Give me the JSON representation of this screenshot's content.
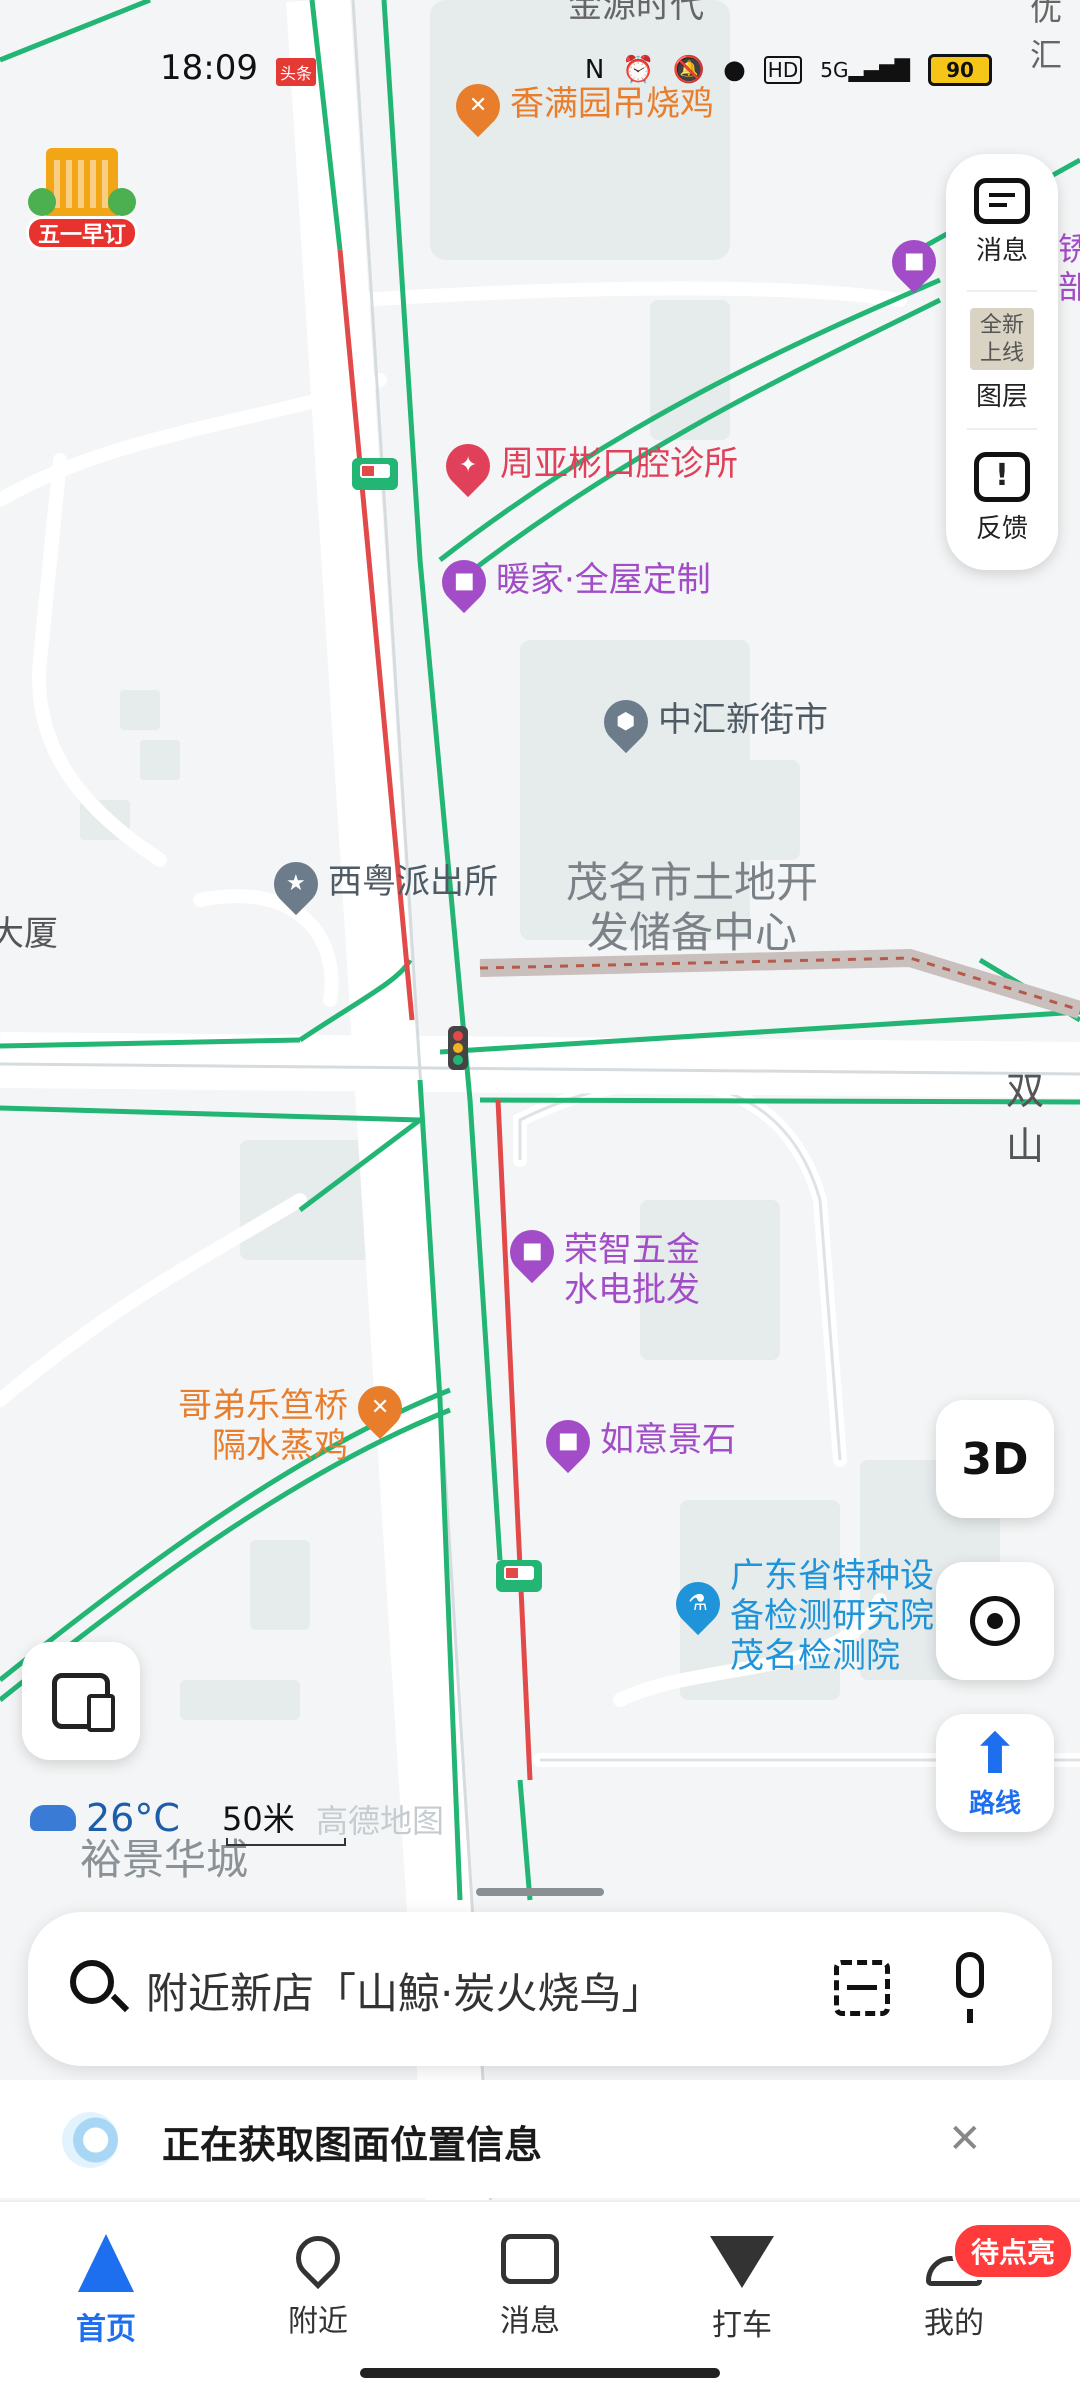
{
  "status_bar": {
    "time": "18:09",
    "news_badge": "头条",
    "network": "5G",
    "battery": "90"
  },
  "promo": {
    "label": "五一早订"
  },
  "side_panel": {
    "messages": "消息",
    "layers": "图层",
    "layers_thumb": "全新上线",
    "feedback": "反馈"
  },
  "map": {
    "pois": [
      {
        "label": "香满园吊烧鸡",
        "category": "food",
        "color": "#e87d2c"
      },
      {
        "label": "周亚彬口腔诊所",
        "category": "clinic",
        "color": "#e0405a"
      },
      {
        "label": "暖家·全屋定制",
        "category": "shop",
        "color": "#a24cc8"
      },
      {
        "label": "中汇新街市",
        "category": "market",
        "color": "#6d7c8a"
      },
      {
        "label": "西粤派出所",
        "category": "police",
        "color": "#6d7c8a"
      },
      {
        "label": "荣智五金\n水电批发",
        "category": "shop",
        "color": "#a24cc8"
      },
      {
        "label": "哥弟乐笪桥\n隔水蒸鸡",
        "category": "food",
        "color": "#e87d2c"
      },
      {
        "label": "如意景石",
        "category": "shop",
        "color": "#a24cc8"
      },
      {
        "label": "广东省特种设\n备检测研究院\n茂名检测院",
        "category": "institute",
        "color": "#1f94d8"
      }
    ],
    "area_labels": {
      "land_center": "茂名市土地开\n发储备中心",
      "road_right": "双山",
      "building_left": "大厦",
      "community": "裕景华城",
      "top_cut": "金源时代",
      "top_right_cut": "优汇",
      "right_cut_1": "锈",
      "right_cut_2": "部"
    },
    "watermark": "高德地图"
  },
  "controls": {
    "three_d": "3D",
    "route": "路线"
  },
  "weather": {
    "temp": "26°C"
  },
  "scale": {
    "label": "50米"
  },
  "search": {
    "placeholder": "附近新店「山鯨·炭火烧鸟」"
  },
  "location_status": {
    "text": "正在获取图面位置信息"
  },
  "tabs": [
    {
      "label": "首页",
      "icon": "navigation-arrow-icon",
      "active": true
    },
    {
      "label": "附近",
      "icon": "location-pin-icon",
      "active": false
    },
    {
      "label": "消息",
      "icon": "message-icon",
      "active": false
    },
    {
      "label": "打车",
      "icon": "taxi-icon",
      "active": false
    },
    {
      "label": "我的",
      "icon": "profile-icon",
      "active": false
    }
  ],
  "mine_badge": "待点亮",
  "colors": {
    "accent": "#1e6ff0",
    "road_traffic_green": "#22b573",
    "road_traffic_red": "#e24a4a"
  }
}
